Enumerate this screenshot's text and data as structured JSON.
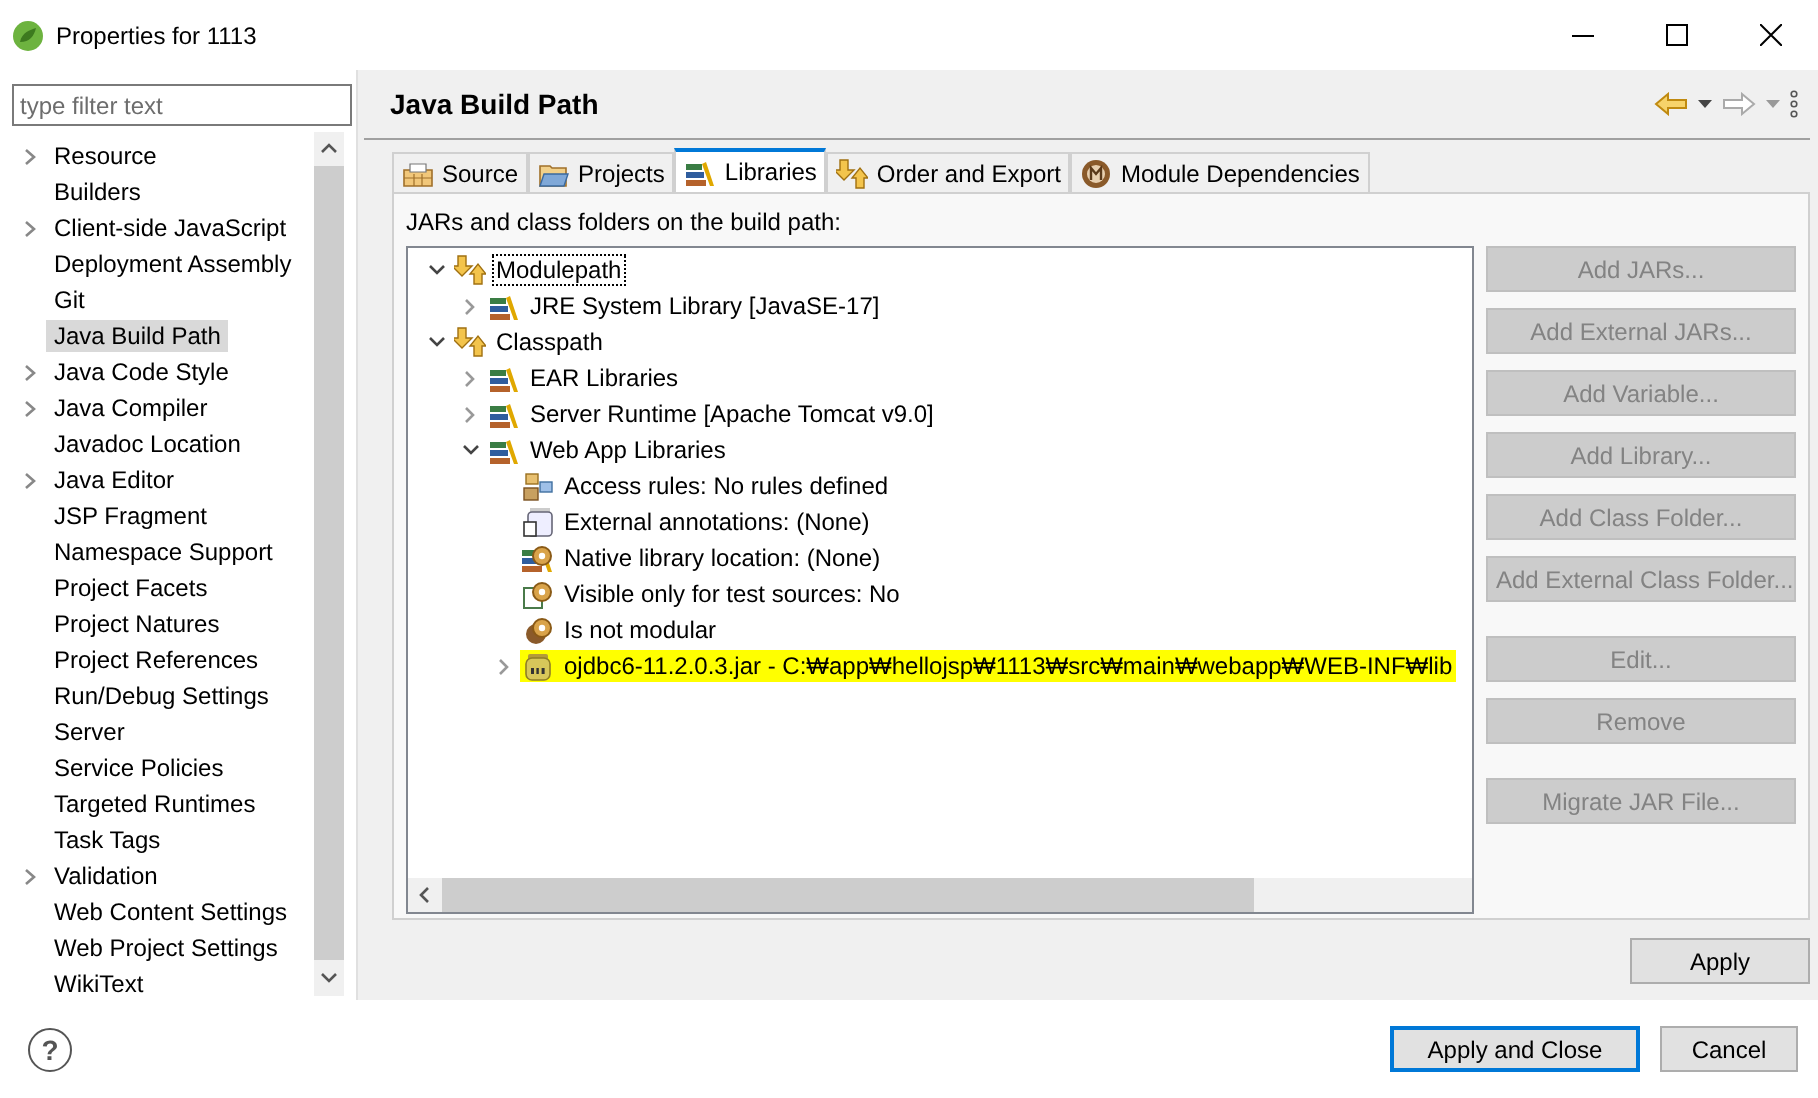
{
  "window": {
    "title": "Properties for 1113"
  },
  "filter": {
    "placeholder": "type filter text"
  },
  "nav": {
    "items": [
      {
        "label": "Resource",
        "expandable": true,
        "selected": false
      },
      {
        "label": "Builders",
        "expandable": false,
        "selected": false
      },
      {
        "label": "Client-side JavaScript",
        "expandable": true,
        "selected": false
      },
      {
        "label": "Deployment Assembly",
        "expandable": false,
        "selected": false
      },
      {
        "label": "Git",
        "expandable": false,
        "selected": false
      },
      {
        "label": "Java Build Path",
        "expandable": false,
        "selected": true
      },
      {
        "label": "Java Code Style",
        "expandable": true,
        "selected": false
      },
      {
        "label": "Java Compiler",
        "expandable": true,
        "selected": false
      },
      {
        "label": "Javadoc Location",
        "expandable": false,
        "selected": false
      },
      {
        "label": "Java Editor",
        "expandable": true,
        "selected": false
      },
      {
        "label": "JSP Fragment",
        "expandable": false,
        "selected": false
      },
      {
        "label": "Namespace Support",
        "expandable": false,
        "selected": false
      },
      {
        "label": "Project Facets",
        "expandable": false,
        "selected": false
      },
      {
        "label": "Project Natures",
        "expandable": false,
        "selected": false
      },
      {
        "label": "Project References",
        "expandable": false,
        "selected": false
      },
      {
        "label": "Run/Debug Settings",
        "expandable": false,
        "selected": false
      },
      {
        "label": "Server",
        "expandable": false,
        "selected": false
      },
      {
        "label": "Service Policies",
        "expandable": false,
        "selected": false
      },
      {
        "label": "Targeted Runtimes",
        "expandable": false,
        "selected": false
      },
      {
        "label": "Task Tags",
        "expandable": false,
        "selected": false
      },
      {
        "label": "Validation",
        "expandable": true,
        "selected": false
      },
      {
        "label": "Web Content Settings",
        "expandable": false,
        "selected": false
      },
      {
        "label": "Web Project Settings",
        "expandable": false,
        "selected": false
      },
      {
        "label": "WikiText",
        "expandable": false,
        "selected": false
      }
    ]
  },
  "page": {
    "title": "Java Build Path"
  },
  "tabs": [
    {
      "label": "Source",
      "kind": "source",
      "selected": false
    },
    {
      "label": "Projects",
      "kind": "projects",
      "selected": false
    },
    {
      "label": "Libraries",
      "kind": "libraries",
      "selected": true
    },
    {
      "label": "Order and Export",
      "kind": "order",
      "selected": false
    },
    {
      "label": "Module Dependencies",
      "kind": "modules",
      "selected": false
    }
  ],
  "libraries": {
    "caption": "JARs and class folders on the build path:",
    "tree": [
      {
        "label": "Modulepath",
        "kind": "path-group",
        "expanded": true,
        "focused": true,
        "highlighted": false,
        "children": [
          {
            "label": "JRE System Library [JavaSE-17]",
            "kind": "library",
            "expanded": false,
            "focused": false,
            "highlighted": false
          }
        ]
      },
      {
        "label": "Classpath",
        "kind": "path-group",
        "expanded": true,
        "focused": false,
        "highlighted": false,
        "children": [
          {
            "label": "EAR Libraries",
            "kind": "library",
            "expanded": false,
            "focused": false,
            "highlighted": false
          },
          {
            "label": "Server Runtime [Apache Tomcat v9.0]",
            "kind": "library",
            "expanded": false,
            "focused": false,
            "highlighted": false
          },
          {
            "label": "Web App Libraries",
            "kind": "library",
            "expanded": true,
            "focused": false,
            "highlighted": false,
            "children": [
              {
                "label": "Access rules: No rules defined",
                "kind": "access-rules",
                "focused": false,
                "highlighted": false
              },
              {
                "label": "External annotations: (None)",
                "kind": "annotations",
                "focused": false,
                "highlighted": false
              },
              {
                "label": "Native library location: (None)",
                "kind": "native",
                "focused": false,
                "highlighted": false
              },
              {
                "label": "Visible only for test sources: No",
                "kind": "test",
                "focused": false,
                "highlighted": false
              },
              {
                "label": "Is not modular",
                "kind": "module",
                "focused": false,
                "highlighted": false
              },
              {
                "label": "ojdbc6-11.2.0.3.jar - C:₩app₩hellojsp₩1113₩src₩main₩webapp₩WEB-INF₩lib",
                "kind": "jar",
                "expanded": false,
                "focused": false,
                "highlighted": true
              }
            ]
          }
        ]
      }
    ],
    "buttons": [
      [
        {
          "label": "Add JARs...",
          "disabled": true
        },
        {
          "label": "Add External JARs...",
          "disabled": true
        },
        {
          "label": "Add Variable...",
          "disabled": true
        },
        {
          "label": "Add Library...",
          "disabled": true
        },
        {
          "label": "Add Class Folder...",
          "disabled": true
        },
        {
          "label": "Add External Class Folder...",
          "disabled": true
        }
      ],
      [
        {
          "label": "Edit...",
          "disabled": true
        },
        {
          "label": "Remove",
          "disabled": true
        }
      ],
      [
        {
          "label": "Migrate JAR File...",
          "disabled": true
        }
      ]
    ]
  },
  "apply": {
    "label": "Apply"
  },
  "footer": {
    "help": "?",
    "buttons": [
      {
        "label": "Apply and Close",
        "default": true
      },
      {
        "label": "Cancel",
        "default": false
      }
    ]
  }
}
